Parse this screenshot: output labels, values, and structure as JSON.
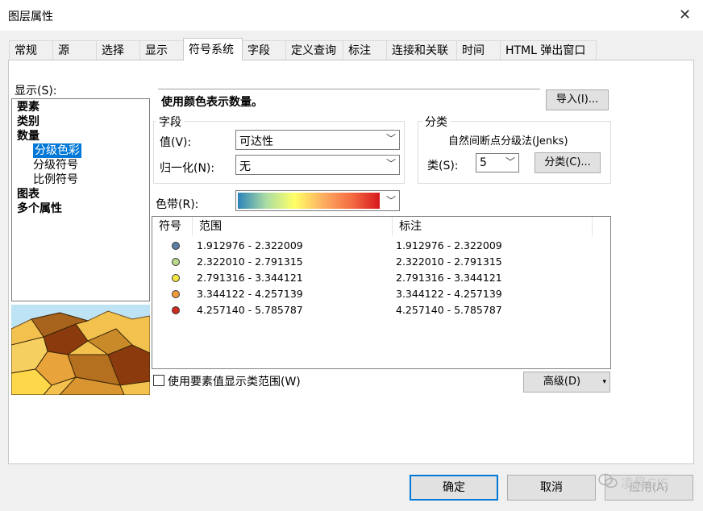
{
  "window": {
    "title": "图层属性",
    "close_glyph": "✕"
  },
  "tabs": [
    {
      "label": "常规"
    },
    {
      "label": "源"
    },
    {
      "label": "选择"
    },
    {
      "label": "显示"
    },
    {
      "label": "符号系统"
    },
    {
      "label": "字段"
    },
    {
      "label": "定义查询"
    },
    {
      "label": "标注"
    },
    {
      "label": "连接和关联"
    },
    {
      "label": "时间"
    },
    {
      "label": "HTML 弹出窗口"
    }
  ],
  "active_tab": "符号系统",
  "show": {
    "label": "显示(S):",
    "tree": [
      {
        "label": "要素"
      },
      {
        "label": "类别"
      },
      {
        "label": "数量"
      },
      {
        "label": "分级色彩"
      },
      {
        "label": "分级符号"
      },
      {
        "label": "比例符号"
      },
      {
        "label": "图表"
      },
      {
        "label": "多个属性"
      }
    ]
  },
  "description": "使用颜色表示数量。",
  "import_button": "导入(I)...",
  "fields": {
    "group_label": "字段",
    "value_label": "值(V):",
    "value": "可达性",
    "normalize_label": "归一化(N):",
    "normalize": "无"
  },
  "classification": {
    "group_label": "分类",
    "method": "自然间断点分级法(Jenks)",
    "classes_label": "类(S):",
    "classes": "5",
    "classify_button": "分类(C)..."
  },
  "color_ramp": {
    "label": "色带(R):",
    "stops": [
      "#2b83ba",
      "#abdda4",
      "#ffff66",
      "#fdae61",
      "#f46d43",
      "#d7191c"
    ]
  },
  "table": {
    "headers": {
      "symbol": "符号",
      "range": "范围",
      "label": "标注"
    },
    "rows": [
      {
        "color": "#5b7fa6",
        "range": "1.912976 - 2.322009",
        "label": "1.912976 - 2.322009"
      },
      {
        "color": "#b8d98a",
        "range": "2.322010 - 2.791315",
        "label": "2.322010 - 2.791315"
      },
      {
        "color": "#f5e642",
        "range": "2.791316 - 3.344121",
        "label": "2.791316 - 3.344121"
      },
      {
        "color": "#f39b3c",
        "range": "3.344122 - 4.257139",
        "label": "3.344122 - 4.257139"
      },
      {
        "color": "#cc2b1d",
        "range": "4.257140 - 5.785787",
        "label": "4.257140 - 5.785787"
      }
    ]
  },
  "show_range_checkbox": "使用要素值显示类范围(W)",
  "advanced_button": "高级(D)",
  "buttons": {
    "ok": "确定",
    "cancel": "取消",
    "apply": "应用(A)"
  },
  "watermark": "凌晨GIS"
}
